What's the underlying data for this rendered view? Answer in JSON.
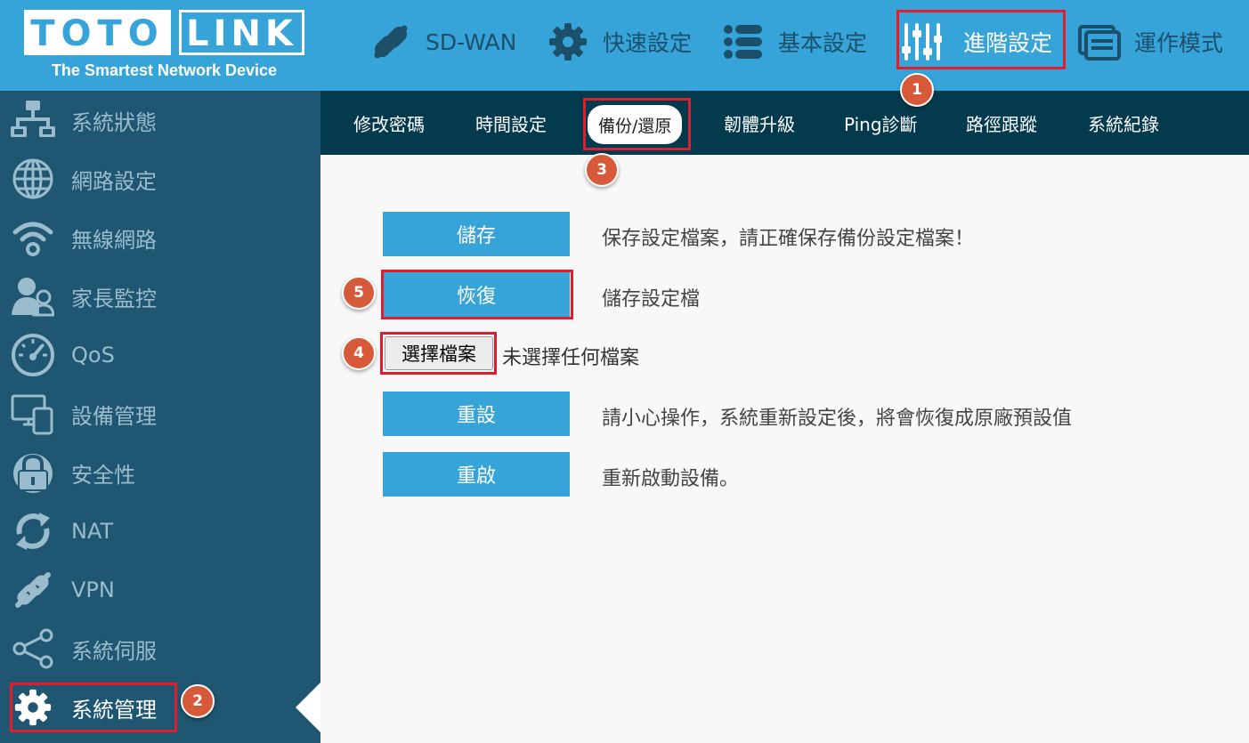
{
  "brand": {
    "logo_left": "TOTO",
    "logo_right": "LINK",
    "tagline": "The Smartest Network Device"
  },
  "topnav": [
    {
      "label": "SD-WAN",
      "icon": "link-icon"
    },
    {
      "label": "快速設定",
      "icon": "gear-icon"
    },
    {
      "label": "基本設定",
      "icon": "list-icon"
    },
    {
      "label": "進階設定",
      "icon": "sliders-icon",
      "active": true
    },
    {
      "label": "運作模式",
      "icon": "window-icon"
    }
  ],
  "sidebar": [
    {
      "label": "系統狀態",
      "icon": "network-topology-icon"
    },
    {
      "label": "網路設定",
      "icon": "globe-icon"
    },
    {
      "label": "無線網路",
      "icon": "wifi-icon"
    },
    {
      "label": "家長監控",
      "icon": "parental-users-icon"
    },
    {
      "label": "QoS",
      "icon": "speedometer-icon"
    },
    {
      "label": "設備管理",
      "icon": "devices-icon"
    },
    {
      "label": "安全性",
      "icon": "lock-icon"
    },
    {
      "label": "NAT",
      "icon": "refresh-icon"
    },
    {
      "label": "VPN",
      "icon": "link-icon"
    },
    {
      "label": "系統伺服",
      "icon": "share-icon"
    },
    {
      "label": "系統管理",
      "icon": "gear-icon",
      "active": true
    }
  ],
  "subnav": [
    {
      "label": "修改密碼"
    },
    {
      "label": "時間設定"
    },
    {
      "label": "備份/還原",
      "active": true
    },
    {
      "label": "韌體升級"
    },
    {
      "label": "Ping診斷"
    },
    {
      "label": "路徑跟蹤"
    },
    {
      "label": "系統紀錄"
    }
  ],
  "content": {
    "save": {
      "button": "儲存",
      "desc": "保存設定檔案，請正確保存備份設定檔案！"
    },
    "restore": {
      "button": "恢復",
      "desc": "儲存設定檔"
    },
    "file": {
      "button": "選擇檔案",
      "status": "未選擇任何檔案"
    },
    "reset": {
      "button": "重設",
      "desc": "請小心操作，系統重新設定後，將會恢復成原廠預設值"
    },
    "reboot": {
      "button": "重啟",
      "desc": "重新啟動設備。"
    }
  },
  "annotations": {
    "steps": [
      "1",
      "2",
      "3",
      "4",
      "5"
    ]
  },
  "colors": {
    "header": "#36a4d8",
    "sidebar": "#1f5672",
    "subnav": "#043a4d",
    "button": "#36a4d8",
    "highlight": "#e01e2b",
    "badge": "#d65a3a"
  }
}
